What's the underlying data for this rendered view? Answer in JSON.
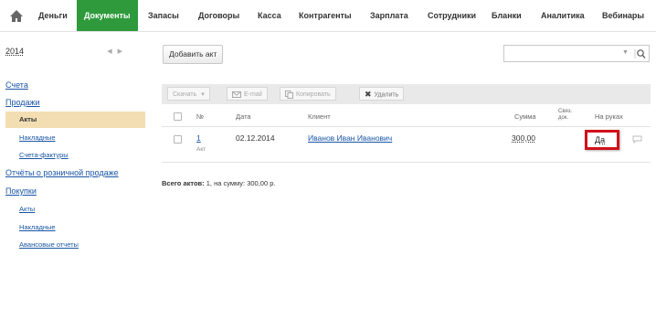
{
  "nav": {
    "home_icon": "home-icon",
    "items": [
      "Деньги",
      "Документы",
      "Запасы",
      "Договоры",
      "Касса",
      "Контрагенты",
      "Зарплата",
      "Сотрудники",
      "Бланки",
      "Аналитика",
      "Вебинары"
    ],
    "active_index": 1,
    "active_color": "#2e9a3c"
  },
  "sidebar": {
    "year": "2014",
    "year_arrows": "◀ ▶",
    "links": {
      "accounts": "Счета",
      "sales": "Продажи",
      "sales_acts": "Акты",
      "sales_invoices": "Накладные",
      "sales_tax_invoices": "Счета-фактуры",
      "retail_reports": "Отчёты о розничной продаже",
      "purchases": "Покупки",
      "purchases_acts": "Акты",
      "purchases_invoices": "Накладные",
      "advance_reports": "Авансовые отчеты"
    },
    "active_color": "#f3deb4"
  },
  "main": {
    "add_button": "Добавить акт",
    "search": {
      "placeholder": "",
      "value": ""
    },
    "toolbar": {
      "download": "Скачать",
      "email": "E-mail",
      "copy": "Копировать",
      "delete": "Удалить"
    },
    "table": {
      "headers": {
        "number": "№",
        "date": "Дата",
        "client": "Клиент",
        "amount": "Сумма",
        "linked_docs": "Связ. док.",
        "on_hand": "На руках"
      },
      "rows": [
        {
          "number": "1",
          "type": "Акт",
          "date": "02.12.2014",
          "client": "Иванов Иван Иванович",
          "amount": "300,00",
          "on_hand": "Да"
        }
      ]
    },
    "summary": {
      "label": "Всего актов:",
      "text": "1, на сумму: 300,00 р."
    }
  },
  "colors": {
    "link": "#1a56a6",
    "highlight_border": "#d0111b"
  }
}
